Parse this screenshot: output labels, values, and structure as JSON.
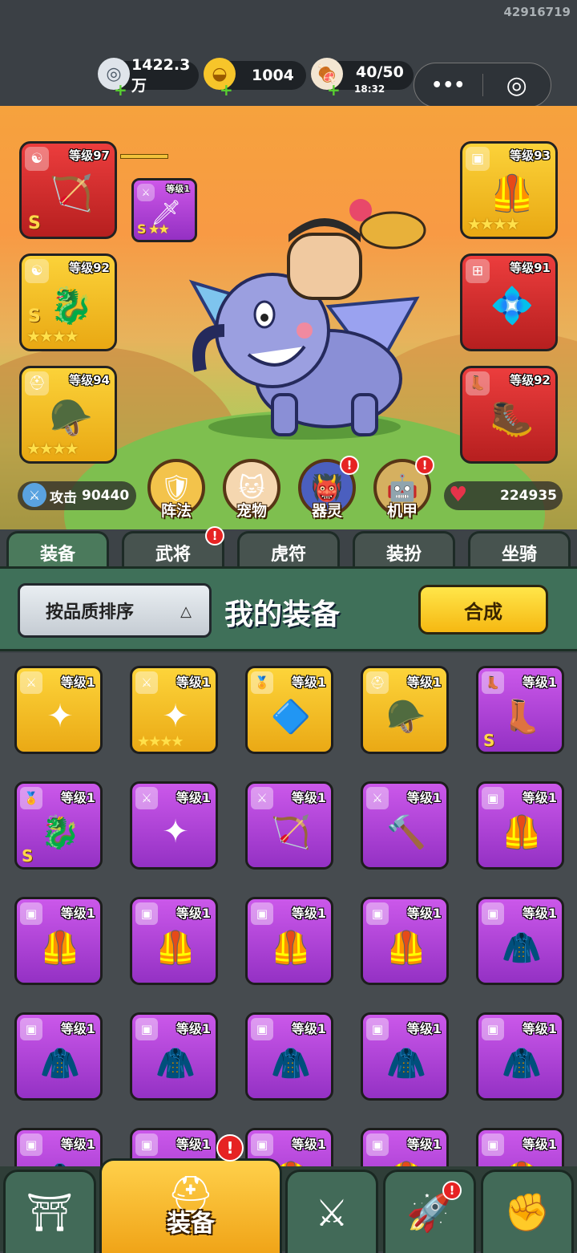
{
  "uid": "42916719",
  "resources": {
    "silver": {
      "icon": "silver-coin-icon",
      "value": "1422.3万"
    },
    "gold": {
      "icon": "gold-ingot-icon",
      "value": "1004"
    },
    "stamina": {
      "icon": "meat-icon",
      "value": "40/50",
      "timer": "18:32"
    }
  },
  "capsule": {
    "more": "•••",
    "close": "◎"
  },
  "equipped": {
    "weapon": {
      "level": "等级97",
      "grade": "S",
      "icon": "crossbow-icon",
      "badge": "yin-yang-icon"
    },
    "weapon_sub": {
      "level": "等级1",
      "stars": "★★",
      "grade": "S",
      "icon": "blue-sword-icon",
      "badge": "sword-icon"
    },
    "amulet": {
      "level": "等级92",
      "stars": "★★★★",
      "grade": "S",
      "icon": "dragon-amulet-icon",
      "badge": "yin-yang-icon"
    },
    "helmet": {
      "level": "等级94",
      "stars": "★★★★",
      "icon": "red-helmet-icon",
      "badge": "helmet-icon"
    },
    "armor": {
      "level": "等级93",
      "stars": "★★★★",
      "icon": "red-armor-icon",
      "badge": "armor-icon"
    },
    "bracer": {
      "level": "等级91",
      "icon": "bracer-icon",
      "badge": "bracer-icon"
    },
    "boots": {
      "level": "等级92",
      "icon": "boots-icon",
      "badge": "boot-icon"
    }
  },
  "stats": {
    "attack_label": "攻击",
    "attack": "90440",
    "hp": "224935"
  },
  "features": [
    {
      "label": "阵法",
      "icon": "formation-icon",
      "alert": false
    },
    {
      "label": "宠物",
      "icon": "cat-pet-icon",
      "alert": false
    },
    {
      "label": "器灵",
      "icon": "spirit-icon",
      "alert": true
    },
    {
      "label": "机甲",
      "icon": "mecha-icon",
      "alert": true
    }
  ],
  "tabs": [
    {
      "label": "装备",
      "alert": false
    },
    {
      "label": "武将",
      "alert": true
    },
    {
      "label": "虎符",
      "alert": false
    },
    {
      "label": "装扮",
      "alert": false
    },
    {
      "label": "坐骑",
      "alert": false
    }
  ],
  "panel": {
    "sort_label": "按品质排序",
    "title": "我的装备",
    "merge_label": "合成"
  },
  "alert_mark": "!",
  "inventory": [
    {
      "level": "等级1",
      "rarity": "gold",
      "stars": "",
      "grade": "",
      "icon": "shuriken-icon",
      "badge": "sword-icon"
    },
    {
      "level": "等级1",
      "rarity": "gold",
      "stars": "★★★★",
      "grade": "",
      "icon": "shuriken-icon",
      "badge": "sword-icon"
    },
    {
      "level": "等级1",
      "rarity": "gold",
      "stars": "",
      "grade": "",
      "icon": "blue-amulet-icon",
      "badge": "medal-icon"
    },
    {
      "level": "等级1",
      "rarity": "gold",
      "stars": "",
      "grade": "",
      "icon": "blue-helmet-icon",
      "badge": "helmet-icon"
    },
    {
      "level": "等级1",
      "rarity": "purple",
      "stars": "",
      "grade": "S",
      "icon": "red-boots-icon",
      "badge": "boot-icon"
    },
    {
      "level": "等级1",
      "rarity": "purple",
      "stars": "",
      "grade": "S",
      "icon": "dragon-amulet-icon",
      "badge": "medal-icon"
    },
    {
      "level": "等级1",
      "rarity": "purple",
      "stars": "",
      "grade": "",
      "icon": "shuriken-icon",
      "badge": "sword-icon"
    },
    {
      "level": "等级1",
      "rarity": "purple",
      "stars": "",
      "grade": "",
      "icon": "bow-icon",
      "badge": "sword-icon"
    },
    {
      "level": "等级1",
      "rarity": "purple",
      "stars": "",
      "grade": "",
      "icon": "club-icon",
      "badge": "sword-icon"
    },
    {
      "level": "等级1",
      "rarity": "purple",
      "stars": "",
      "grade": "",
      "icon": "gold-armor-icon",
      "badge": "armor-icon"
    },
    {
      "level": "等级1",
      "rarity": "purple",
      "stars": "",
      "grade": "",
      "icon": "gold-armor-icon",
      "badge": "armor-icon"
    },
    {
      "level": "等级1",
      "rarity": "purple",
      "stars": "",
      "grade": "",
      "icon": "gold-armor-icon",
      "badge": "armor-icon"
    },
    {
      "level": "等级1",
      "rarity": "purple",
      "stars": "",
      "grade": "",
      "icon": "gold-armor-icon",
      "badge": "armor-icon"
    },
    {
      "level": "等级1",
      "rarity": "purple",
      "stars": "",
      "grade": "",
      "icon": "gold-armor-icon",
      "badge": "armor-icon"
    },
    {
      "level": "等级1",
      "rarity": "purple",
      "stars": "",
      "grade": "",
      "icon": "blue-armor-icon",
      "badge": "armor-icon"
    },
    {
      "level": "等级1",
      "rarity": "purple",
      "stars": "",
      "grade": "",
      "icon": "blue-armor-icon",
      "badge": "armor-icon"
    },
    {
      "level": "等级1",
      "rarity": "purple",
      "stars": "",
      "grade": "",
      "icon": "blue-armor-icon",
      "badge": "armor-icon"
    },
    {
      "level": "等级1",
      "rarity": "purple",
      "stars": "",
      "grade": "",
      "icon": "blue-armor-icon",
      "badge": "armor-icon"
    },
    {
      "level": "等级1",
      "rarity": "purple",
      "stars": "",
      "grade": "",
      "icon": "blue-armor-icon",
      "badge": "armor-icon"
    },
    {
      "level": "等级1",
      "rarity": "purple",
      "stars": "",
      "grade": "",
      "icon": "blue-armor-icon",
      "badge": "armor-icon"
    },
    {
      "level": "等级1",
      "rarity": "purple",
      "stars": "",
      "grade": "",
      "icon": "blue-armor-icon",
      "badge": "armor-icon"
    },
    {
      "level": "等级1",
      "rarity": "purple",
      "stars": "",
      "grade": "",
      "icon": "blue-armor-icon",
      "badge": "armor-icon"
    },
    {
      "level": "等级1",
      "rarity": "purple",
      "stars": "",
      "grade": "",
      "icon": "gold-armor-icon",
      "badge": "armor-icon"
    },
    {
      "level": "等级1",
      "rarity": "purple",
      "stars": "",
      "grade": "",
      "icon": "gold-armor-icon",
      "badge": "armor-icon"
    },
    {
      "level": "等级1",
      "rarity": "purple",
      "stars": "",
      "grade": "",
      "icon": "gold-armor-icon",
      "badge": "armor-icon"
    }
  ],
  "bottom_nav": [
    {
      "icon": "treasury-gate-icon",
      "label": "",
      "alert": false
    },
    {
      "icon": "knight-helmet-icon",
      "label": "装备",
      "alert": true
    },
    {
      "icon": "crossed-swords-icon",
      "label": "",
      "alert": false
    },
    {
      "icon": "rocket-icon",
      "label": "",
      "alert": true
    },
    {
      "icon": "fist-upgrade-icon",
      "label": "",
      "alert": false
    }
  ],
  "colors": {
    "gold_slot": "#fbd239",
    "purple_slot": "#cd57e8",
    "red_slot": "#ec3d3d",
    "panel_green": "#3f7059",
    "alert_red": "#e62323"
  }
}
